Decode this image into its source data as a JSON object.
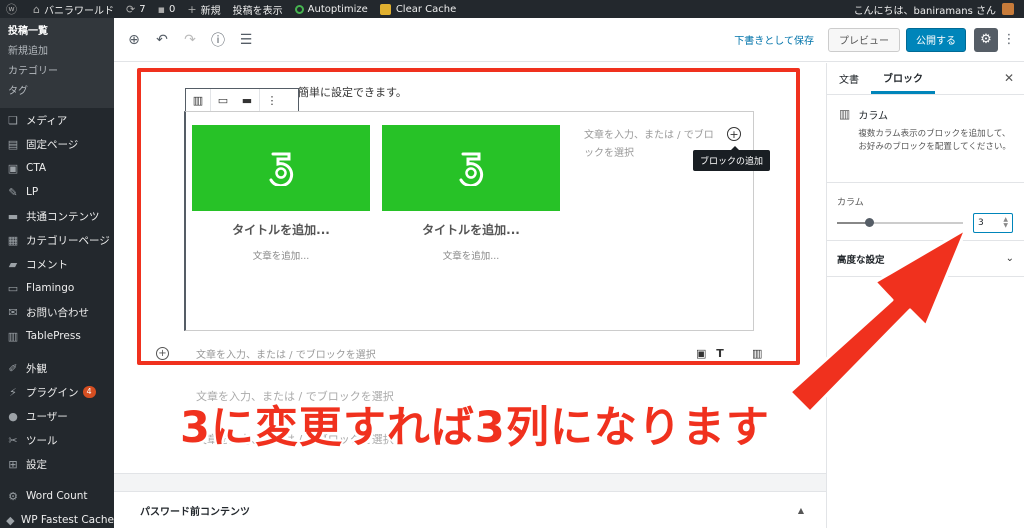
{
  "adminbar": {
    "site_name": "バニラワールド",
    "updates_count": "7",
    "comments_count": "0",
    "new_label": "新規",
    "view_post_label": "投稿を表示",
    "autoptimize_label": "Autoptimize",
    "clear_cache_label": "Clear Cache",
    "greeting": "こんにちは、baniramans さん"
  },
  "sidebar": {
    "submenu": [
      {
        "label": "投稿一覧",
        "current": true
      },
      {
        "label": "新規追加"
      },
      {
        "label": "カテゴリー"
      },
      {
        "label": "タグ"
      }
    ],
    "items": [
      {
        "label": "メディア",
        "icon": "media-icon"
      },
      {
        "label": "固定ページ",
        "icon": "pages-icon"
      },
      {
        "label": "CTA",
        "icon": "cta-icon"
      },
      {
        "label": "LP",
        "icon": "lp-icon"
      },
      {
        "label": "共通コンテンツ",
        "icon": "folder-icon"
      },
      {
        "label": "カテゴリーページ",
        "icon": "category-page-icon"
      },
      {
        "label": "コメント",
        "icon": "comment-icon"
      },
      {
        "label": "Flamingo",
        "icon": "flamingo-icon"
      },
      {
        "label": "お問い合わせ",
        "icon": "mail-icon"
      },
      {
        "label": "TablePress",
        "icon": "table-icon"
      },
      {
        "label": "外観",
        "icon": "appearance-icon"
      },
      {
        "label": "プラグイン",
        "icon": "plugin-icon",
        "badge": "4"
      },
      {
        "label": "ユーザー",
        "icon": "user-icon"
      },
      {
        "label": "ツール",
        "icon": "tools-icon"
      },
      {
        "label": "設定",
        "icon": "settings-icon"
      },
      {
        "label": "Word Count",
        "icon": "gear-icon"
      },
      {
        "label": "WP Fastest Cache",
        "icon": "cache-icon"
      }
    ]
  },
  "header": {
    "save_draft": "下書きとして保存",
    "preview": "プレビュー",
    "publish": "公開する"
  },
  "canvas": {
    "top_text": "簡単に設定できます。",
    "columns": [
      {
        "title": "タイトルを追加...",
        "text": "文章を追加..."
      },
      {
        "title": "タイトルを追加...",
        "text": "文章を追加..."
      }
    ],
    "col3_placeholder": "文章を入力、または / でブロックを選択",
    "tooltip": "ブロックの追加",
    "appender_placeholder": "文章を入力、または / でブロックを選択",
    "ghost_text_1": "文章を入力、または / でブロックを選択",
    "ghost_text_2": "文章を入力、または / でブロックを選択",
    "caption": "3に変更すれば3列になります",
    "meta_box_title": "パスワード前コンテンツ"
  },
  "panel": {
    "tab_document": "文書",
    "tab_block": "ブロック",
    "block_name": "カラム",
    "block_desc": "複数カラム表示のブロックを追加して、お好みのブロックを配置してください。",
    "columns_label": "カラム",
    "columns_value": "3",
    "columns_fraction": 0.25,
    "advanced": "高度な設定"
  },
  "colors": {
    "annotation_red": "#f0311e",
    "image_green": "#27c227",
    "accent_blue": "#0085ba",
    "admin_dark": "#23282d"
  }
}
